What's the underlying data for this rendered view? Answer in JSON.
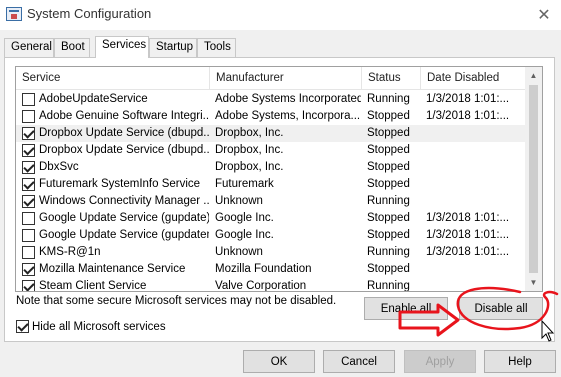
{
  "window": {
    "title": "System Configuration"
  },
  "tabs": [
    {
      "label": "General"
    },
    {
      "label": "Boot"
    },
    {
      "label": "Services",
      "active": true
    },
    {
      "label": "Startup"
    },
    {
      "label": "Tools"
    }
  ],
  "table": {
    "columns": [
      "Service",
      "Manufacturer",
      "Status",
      "Date Disabled"
    ],
    "rows": [
      {
        "checked": false,
        "service": "AdobeUpdateService",
        "manufacturer": "Adobe Systems Incorporated",
        "status": "Running",
        "date_disabled": "1/3/2018 1:01:..."
      },
      {
        "checked": false,
        "service": "Adobe Genuine Software Integri...",
        "manufacturer": "Adobe Systems, Incorpora...",
        "status": "Stopped",
        "date_disabled": "1/3/2018 1:01:..."
      },
      {
        "checked": true,
        "service": "Dropbox Update Service (dbupd...",
        "manufacturer": "Dropbox, Inc.",
        "status": "Stopped",
        "date_disabled": "",
        "selected": true
      },
      {
        "checked": true,
        "service": "Dropbox Update Service (dbupd...",
        "manufacturer": "Dropbox, Inc.",
        "status": "Stopped",
        "date_disabled": ""
      },
      {
        "checked": true,
        "service": "DbxSvc",
        "manufacturer": "Dropbox, Inc.",
        "status": "Stopped",
        "date_disabled": ""
      },
      {
        "checked": true,
        "service": "Futuremark SystemInfo Service",
        "manufacturer": "Futuremark",
        "status": "Stopped",
        "date_disabled": ""
      },
      {
        "checked": true,
        "service": "Windows Connectivity Manager ...",
        "manufacturer": "Unknown",
        "status": "Running",
        "date_disabled": ""
      },
      {
        "checked": false,
        "service": "Google Update Service (gupdate)",
        "manufacturer": "Google Inc.",
        "status": "Stopped",
        "date_disabled": "1/3/2018 1:01:..."
      },
      {
        "checked": false,
        "service": "Google Update Service (gupdatem)",
        "manufacturer": "Google Inc.",
        "status": "Stopped",
        "date_disabled": "1/3/2018 1:01:..."
      },
      {
        "checked": false,
        "service": "KMS-R@1n",
        "manufacturer": "Unknown",
        "status": "Running",
        "date_disabled": "1/3/2018 1:01:..."
      },
      {
        "checked": true,
        "service": "Mozilla Maintenance Service",
        "manufacturer": "Mozilla Foundation",
        "status": "Stopped",
        "date_disabled": ""
      },
      {
        "checked": true,
        "service": "Steam Client Service",
        "manufacturer": "Valve Corporation",
        "status": "Running",
        "date_disabled": ""
      }
    ]
  },
  "note": "Note that some secure Microsoft services may not be disabled.",
  "buttons": {
    "enable_all": "Enable all",
    "disable_all": "Disable all",
    "ok": "OK",
    "cancel": "Cancel",
    "apply": "Apply",
    "help": "Help"
  },
  "hide_microsoft": {
    "label": "Hide all Microsoft services",
    "checked": true
  },
  "colors": {
    "annotation": "#e8141c",
    "window_bg": "#f0f0f0",
    "button_bg": "#e1e1e1"
  },
  "icons": [
    "system-configuration-icon",
    "close-icon",
    "scroll-up-icon",
    "scroll-down-icon",
    "mouse-cursor-icon"
  ]
}
